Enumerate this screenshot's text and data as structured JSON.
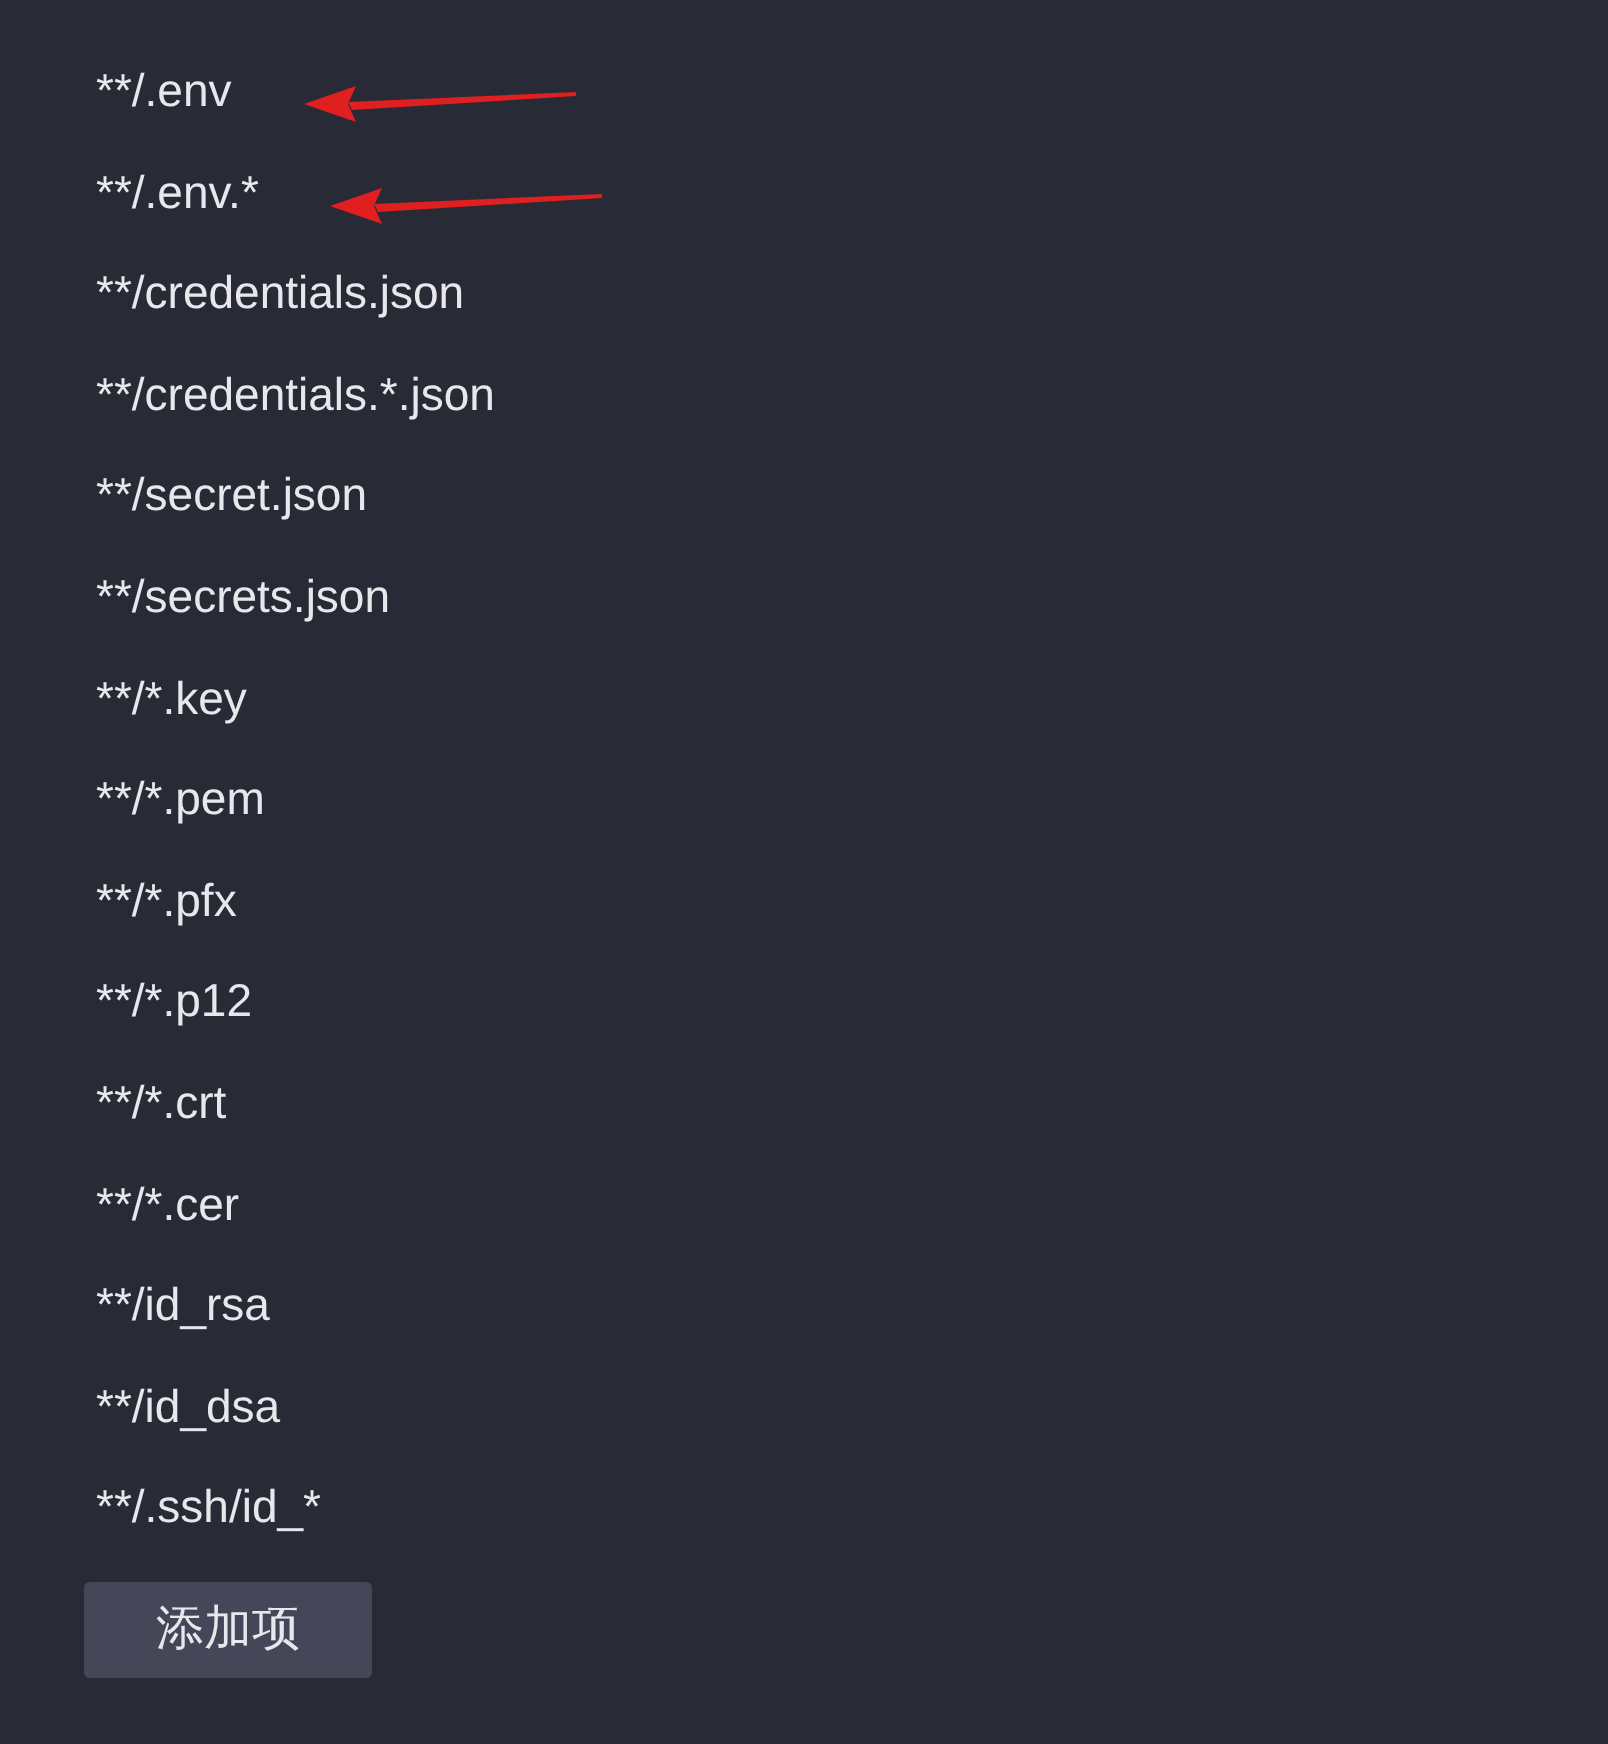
{
  "patterns": [
    {
      "text": "**/.env",
      "highlighted": true
    },
    {
      "text": "**/.env.*",
      "highlighted": true
    },
    {
      "text": "**/credentials.json",
      "highlighted": false
    },
    {
      "text": "**/credentials.*.json",
      "highlighted": false
    },
    {
      "text": "**/secret.json",
      "highlighted": false
    },
    {
      "text": "**/secrets.json",
      "highlighted": false
    },
    {
      "text": "**/*.key",
      "highlighted": false
    },
    {
      "text": "**/*.pem",
      "highlighted": false
    },
    {
      "text": "**/*.pfx",
      "highlighted": false
    },
    {
      "text": "**/*.p12",
      "highlighted": false
    },
    {
      "text": "**/*.crt",
      "highlighted": false
    },
    {
      "text": "**/*.cer",
      "highlighted": false
    },
    {
      "text": "**/id_rsa",
      "highlighted": false
    },
    {
      "text": "**/id_dsa",
      "highlighted": false
    },
    {
      "text": "**/.ssh/id_*",
      "highlighted": false
    }
  ],
  "add_button": "添加项"
}
